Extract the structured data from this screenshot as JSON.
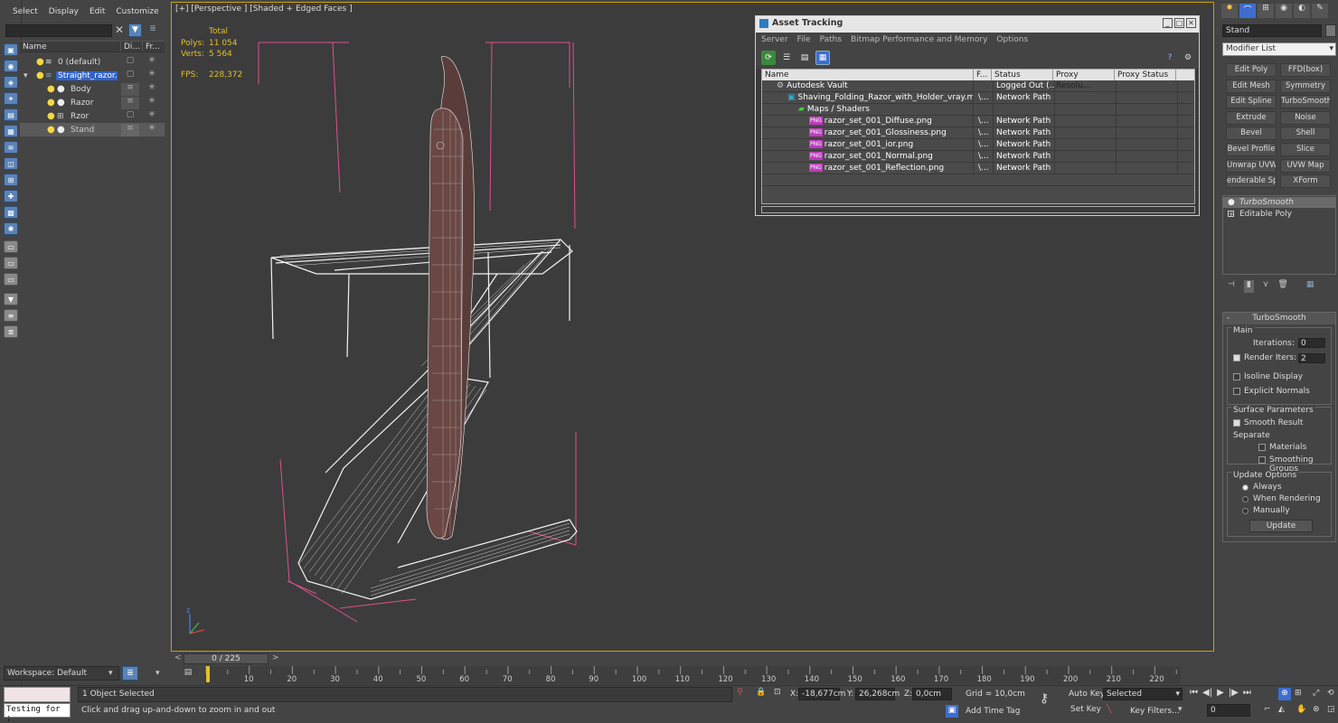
{
  "scene_explorer": {
    "menu": [
      "Select",
      "Display",
      "Edit",
      "Customize"
    ],
    "columns": [
      "Name",
      "Di...",
      "Fr..."
    ],
    "rows": [
      {
        "name": "0 (default)",
        "level": 1
      },
      {
        "name": "Straight_razor...",
        "level": 1,
        "selected": true
      },
      {
        "name": "Body",
        "level": 2
      },
      {
        "name": "Razor",
        "level": 2
      },
      {
        "name": "Rzor",
        "level": 2
      },
      {
        "name": "Stand",
        "level": 2,
        "active": true
      }
    ],
    "workspace": "Workspace: Default"
  },
  "viewport": {
    "label": "[+] [Perspective ] [Shaded + Edged Faces ]",
    "stats": {
      "total_label": "Total",
      "polys_label": "Polys:",
      "polys_value": "11 054",
      "verts_label": "Verts:",
      "verts_value": "5 564",
      "fps_label": "FPS:",
      "fps_value": "228,372"
    }
  },
  "asset_tracking": {
    "title": "Asset Tracking",
    "menu": [
      "Server",
      "File",
      "Paths",
      "Bitmap Performance and Memory",
      "Options"
    ],
    "columns": [
      "Name",
      "F...",
      "Status",
      "Proxy Resolu...",
      "Proxy Status"
    ],
    "rows": [
      {
        "name": "Autodesk Vault",
        "f": "",
        "status": "Logged Out (...",
        "indent": 1,
        "icon": "vault"
      },
      {
        "name": "Shaving_Folding_Razor_with_Holder_vray.max",
        "f": "\\...",
        "status": "Network Path",
        "indent": 2,
        "icon": "max"
      },
      {
        "name": "Maps / Shaders",
        "f": "",
        "status": "",
        "indent": 3,
        "icon": "maps"
      },
      {
        "name": "razor_set_001_Diffuse.png",
        "f": "\\...",
        "status": "Network Path",
        "indent": 4,
        "icon": "png"
      },
      {
        "name": "razor_set_001_Glossiness.png",
        "f": "\\...",
        "status": "Network Path",
        "indent": 4,
        "icon": "png"
      },
      {
        "name": "razor_set_001_ior.png",
        "f": "\\...",
        "status": "Network Path",
        "indent": 4,
        "icon": "png"
      },
      {
        "name": "razor_set_001_Normal.png",
        "f": "\\...",
        "status": "Network Path",
        "indent": 4,
        "icon": "png"
      },
      {
        "name": "razor_set_001_Reflection.png",
        "f": "\\...",
        "status": "Network Path",
        "indent": 4,
        "icon": "png"
      }
    ],
    "png_badge": "PNG"
  },
  "command_panel": {
    "object_name": "Stand",
    "modifier_list": "Modifier List",
    "buttons": [
      [
        "Edit Poly",
        "FFD(box)"
      ],
      [
        "Edit Mesh",
        "Symmetry"
      ],
      [
        "Edit Spline",
        "TurboSmooth"
      ],
      [
        "Extrude",
        "Noise"
      ],
      [
        "Bevel",
        "Shell"
      ],
      [
        "Bevel Profile",
        "Slice"
      ],
      [
        "Unwrap UVW",
        "UVW Map"
      ],
      [
        "enderable Splin",
        "XForm"
      ]
    ],
    "stack": [
      "TurboSmooth",
      "Editable Poly"
    ],
    "turbosmooth": {
      "title": "TurboSmooth",
      "main": "Main",
      "iterations_label": "Iterations:",
      "iterations_value": "0",
      "render_iters_label": "Render Iters:",
      "render_iters_value": "2",
      "isoline": "Isoline Display",
      "explicit": "Explicit Normals",
      "surface": "Surface Parameters",
      "smooth_result": "Smooth Result",
      "separate": "Separate",
      "materials": "Materials",
      "smoothing_groups": "Smoothing Groups",
      "update_options": "Update Options",
      "always": "Always",
      "when_rendering": "When Rendering",
      "manually": "Manually",
      "update": "Update"
    }
  },
  "timeline": {
    "frame": "0 / 225",
    "ticks": [
      "10",
      "20",
      "30",
      "40",
      "50",
      "60",
      "70",
      "80",
      "90",
      "100",
      "110",
      "120",
      "130",
      "140",
      "150",
      "160",
      "170",
      "180",
      "190",
      "200",
      "210",
      "220"
    ]
  },
  "status": {
    "maxscript": "Testing for ;",
    "selected": "1 Object Selected",
    "prompt": "Click and drag up-and-down to zoom in and out",
    "x_label": "X:",
    "x_value": "-18,677cm",
    "y_label": "Y:",
    "y_value": "26,268cm",
    "z_label": "Z:",
    "z_value": "0,0cm",
    "grid": "Grid = 10,0cm",
    "add_time_tag": "Add Time Tag",
    "auto_key": "Auto Key",
    "set_key": "Set Key",
    "selected_dd": "Selected",
    "key_filters": "Key Filters...",
    "frame_field": "0"
  }
}
